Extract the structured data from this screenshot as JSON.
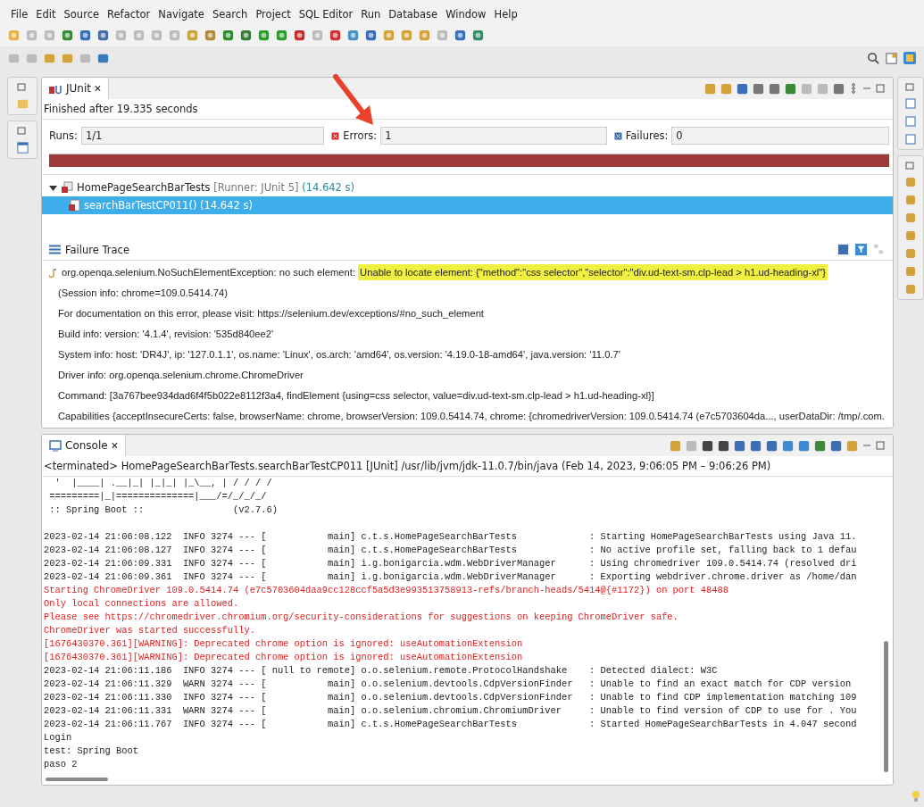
{
  "menu": [
    "File",
    "Edit",
    "Source",
    "Refactor",
    "Navigate",
    "Search",
    "Project",
    "SQL Editor",
    "Run",
    "Database",
    "Window",
    "Help"
  ],
  "junit": {
    "tab_title": "JUnit",
    "close": "🗙",
    "status": "Finished after 19.335 seconds",
    "counters": [
      {
        "label": "Runs:",
        "value": "1/1",
        "kind": "runs"
      },
      {
        "label": "Errors:",
        "value": "1",
        "kind": "errors"
      },
      {
        "label": "Failures:",
        "value": "0",
        "kind": "failures"
      }
    ],
    "bar": {
      "level": 1,
      "failed": true
    },
    "tree": [
      {
        "name": "HomePageSearchBarTests",
        "runner": "[Runner: JUnit 5]",
        "time": "(14.642 s)",
        "expanded": true,
        "selected": false,
        "children": [
          {
            "name": "searchBarTestCP011()",
            "time": "(14.642 s)",
            "selected": true
          }
        ]
      }
    ],
    "failure_trace": {
      "title": "Failure Trace",
      "first_line": {
        "text": "org.openqa.selenium.NoSuchElementException: no such element: ",
        "highlight": "Unable to locate element: {\"method\":\"css selector\",\"selector\":\"div.ud-text-sm.clp-lead > h1.ud-heading-xl\"}"
      },
      "lines": [
        " (Session info: chrome=109.0.5414.74)",
        "For documentation on this error, please visit: https://selenium.dev/exceptions/#no_such_element",
        "Build info: version: '4.1.4', revision: '535d840ee2'",
        "System info: host: 'DR4J', ip: '127.0.1.1', os.name: 'Linux', os.arch: 'amd64', os.version: '4.19.0-18-amd64', java.version: '11.0.7'",
        "Driver info: org.openqa.selenium.chrome.ChromeDriver",
        "Command: [3a767bee934dad6f4f5b022e8112f3a4, findElement {using=css selector, value=div.ud-text-sm.clp-lead > h1.ud-heading-xl}]",
        "Capabilities {acceptInsecureCerts: false, browserName: chrome, browserVersion: 109.0.5414.74, chrome: {chromedriverVersion: 109.0.5414.74 (e7c5703604da..., userDataDir: /tmp/.com."
      ]
    }
  },
  "console": {
    "tab_title": "Console",
    "close": "🗙",
    "description": "<terminated> HomePageSearchBarTests.searchBarTestCP011 [JUnit] /usr/lib/jvm/jdk-11.0.7/bin/java (Feb 14, 2023, 9:06:05 PM – 9:06:26 PM)",
    "lines": [
      {
        "kind": "out",
        "text": "  '  |____| .__|_| |_|_| |_\\__, | / / / /"
      },
      {
        "kind": "out",
        "text": " =========|_|==============|___/=/_/_/_/"
      },
      {
        "kind": "out",
        "text": " :: Spring Boot ::                (v2.7.6)"
      },
      {
        "kind": "blank"
      },
      {
        "kind": "out",
        "text": "2023-02-14 21:06:08.122  INFO 3274 --- [           main] c.t.s.HomePageSearchBarTests             : Starting HomePageSearchBarTests using Java 11."
      },
      {
        "kind": "out",
        "text": "2023-02-14 21:06:08.127  INFO 3274 --- [           main] c.t.s.HomePageSearchBarTests             : No active profile set, falling back to 1 defau"
      },
      {
        "kind": "out",
        "text": "2023-02-14 21:06:09.331  INFO 3274 --- [           main] i.g.bonigarcia.wdm.WebDriverManager      : Using chromedriver 109.0.5414.74 (resolved dri"
      },
      {
        "kind": "out",
        "text": "2023-02-14 21:06:09.361  INFO 3274 --- [           main] i.g.bonigarcia.wdm.WebDriverManager      : Exporting webdriver.chrome.driver as /home/dan"
      },
      {
        "kind": "err",
        "text": "Starting ChromeDriver 109.0.5414.74 (e7c5703604daa9cc128ccf5a5d3e993513758913-refs/branch-heads/5414@{#1172}) on port 48488"
      },
      {
        "kind": "err",
        "text": "Only local connections are allowed."
      },
      {
        "kind": "err",
        "text": "Please see https://chromedriver.chromium.org/security-considerations for suggestions on keeping ChromeDriver safe."
      },
      {
        "kind": "err",
        "text": "ChromeDriver was started successfully."
      },
      {
        "kind": "err",
        "text": "[1676430370.361][WARNING]: Deprecated chrome option is ignored: useAutomationExtension"
      },
      {
        "kind": "err",
        "text": "[1676430370.361][WARNING]: Deprecated chrome option is ignored: useAutomationExtension"
      },
      {
        "kind": "out",
        "text": "2023-02-14 21:06:11.186  INFO 3274 --- [ null to remote] o.o.selenium.remote.ProtocolHandshake    : Detected dialect: W3C"
      },
      {
        "kind": "out",
        "text": "2023-02-14 21:06:11.329  WARN 3274 --- [           main] o.o.selenium.devtools.CdpVersionFinder   : Unable to find an exact match for CDP version"
      },
      {
        "kind": "out",
        "text": "2023-02-14 21:06:11.330  INFO 3274 --- [           main] o.o.selenium.devtools.CdpVersionFinder   : Unable to find CDP implementation matching 109"
      },
      {
        "kind": "out",
        "text": "2023-02-14 21:06:11.331  WARN 3274 --- [           main] o.o.selenium.chromium.ChromiumDriver     : Unable to find version of CDP to use for . You"
      },
      {
        "kind": "out",
        "text": "2023-02-14 21:06:11.767  INFO 3274 --- [           main] c.t.s.HomePageSearchBarTests             : Started HomePageSearchBarTests in 4.047 second"
      },
      {
        "kind": "out",
        "text": "Login"
      },
      {
        "kind": "out",
        "text": "test: Spring Boot"
      },
      {
        "kind": "out",
        "text": "paso 2"
      }
    ]
  }
}
